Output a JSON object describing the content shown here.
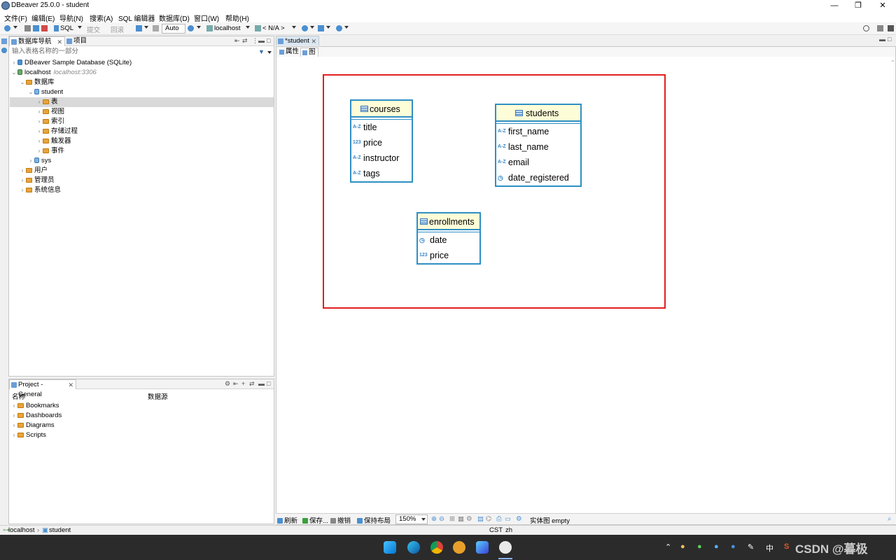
{
  "window": {
    "title": "DBeaver 25.0.0 - student",
    "minimize": "—",
    "restore": "❐",
    "close": "✕"
  },
  "menu": [
    "文件(F)",
    "编辑(E)",
    "导航(N)",
    "搜索(A)",
    "SQL 编辑器",
    "数据库(D)",
    "窗口(W)",
    "帮助(H)"
  ],
  "toolbar": {
    "sql": "SQL",
    "commit": "提交",
    "rollback": "回滚",
    "mode": "Auto",
    "datasource": "localhost",
    "schema": "< N/A >"
  },
  "navigator": {
    "tab_label": "数据库导航",
    "tab2_label": "项目",
    "filter_placeholder": "输入表格名称的一部分",
    "tree": [
      {
        "label": "DBeaver Sample Database (SQLite)",
        "arrow": "›"
      },
      {
        "label": "localhost",
        "sub": "localhost:3306",
        "arrow": "⌄"
      },
      {
        "label": "数据库",
        "arrow": "⌄"
      },
      {
        "label": "student",
        "arrow": "⌄"
      },
      {
        "label": "表",
        "arrow": "›"
      },
      {
        "label": "视图",
        "arrow": "›"
      },
      {
        "label": "索引",
        "arrow": "›"
      },
      {
        "label": "存储过程",
        "arrow": "›"
      },
      {
        "label": "触发器",
        "arrow": "›"
      },
      {
        "label": "事件",
        "arrow": "›"
      },
      {
        "label": "sys",
        "arrow": "›"
      },
      {
        "label": "用户",
        "arrow": "›"
      },
      {
        "label": "管理员",
        "arrow": "›"
      },
      {
        "label": "系统信息",
        "arrow": "›"
      }
    ]
  },
  "project": {
    "tab_label": "Project - General",
    "col_name": "名称",
    "col_datasource": "数据源",
    "items": [
      "Bookmarks",
      "Dashboards",
      "Diagrams",
      "Scripts"
    ]
  },
  "editor": {
    "tab_label": "*student",
    "subtab_properties": "属性",
    "subtab_diagram": "图"
  },
  "diagram": {
    "entities": [
      {
        "name": "courses",
        "columns": [
          {
            "name": "title",
            "icon": "A-Z"
          },
          {
            "name": "price",
            "icon": "123"
          },
          {
            "name": "instructor",
            "icon": "A-Z"
          },
          {
            "name": "tags",
            "icon": "A-Z"
          }
        ]
      },
      {
        "name": "students",
        "columns": [
          {
            "name": "first_name",
            "icon": "A-Z"
          },
          {
            "name": "last_name",
            "icon": "A-Z"
          },
          {
            "name": "email",
            "icon": "A-Z"
          },
          {
            "name": "date_registered",
            "icon": "clock"
          }
        ]
      },
      {
        "name": "enrollments",
        "columns": [
          {
            "name": "date",
            "icon": "clock"
          },
          {
            "name": "price",
            "icon": "123"
          }
        ]
      }
    ]
  },
  "editor_toolbar": {
    "refresh": "刷新",
    "save": "保存...",
    "undo": "撤销",
    "keep_layout": "保持布局",
    "zoom": "150%",
    "status": "实体图 empty"
  },
  "statusbar": {
    "crumb1": "localhost",
    "crumb2": "student",
    "tz": "CST",
    "lang": "zh"
  },
  "taskbar": {
    "ime": "中",
    "watermark": "CSDN @暮极"
  },
  "colors": {
    "entity_border": "#2f8fc4",
    "entity_header": "#fdfdd8",
    "highlight": "#e02020"
  }
}
